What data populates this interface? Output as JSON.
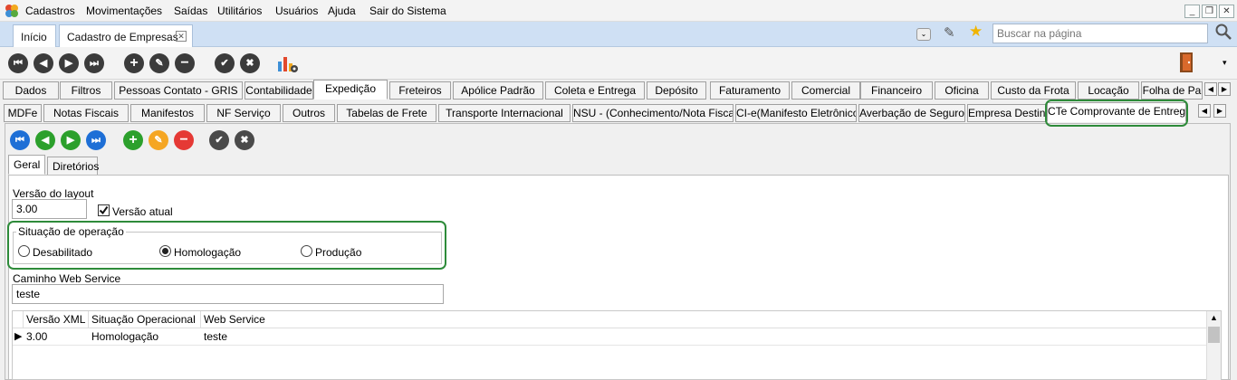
{
  "menu": {
    "items": [
      "Cadastros",
      "Movimentações",
      "Saídas",
      "Utilitários",
      "Usuários",
      "Ajuda",
      "Sair do Sistema"
    ]
  },
  "doc_tabs": {
    "home": "Início",
    "current": "Cadastro de Empresas"
  },
  "search": {
    "placeholder": "Buscar na página"
  },
  "row1_tabs": [
    "Dados",
    "Filtros",
    "Pessoas Contato - GRIS",
    "Contabilidade",
    "Expedição",
    "Freteiros",
    "Apólice Padrão",
    "Coleta e Entrega",
    "Depósito",
    "Faturamento",
    "Comercial",
    "Financeiro",
    "Oficina",
    "Custo da Frota",
    "Locação",
    "Folha de Pa"
  ],
  "row2_tabs": [
    "MDFe",
    "Notas Fiscais",
    "Manifestos",
    "NF Serviço",
    "Outros",
    "Tabelas de Frete",
    "Transporte Internacional",
    "NSU - (Conhecimento/Nota Fiscal)",
    "CI-e(Manifesto Eletrônico)",
    "Averbação de Seguro",
    "Empresa Destino",
    "CTe Comprovante de Entrega"
  ],
  "sub_tabs": {
    "geral": "Geral",
    "diretorios": "Diretórios"
  },
  "form": {
    "layout_label": "Versão do layout",
    "layout_value": "3.00",
    "versao_atual_label": "Versão atual",
    "situacao_label": "Situação de operação",
    "radio_desabilitado": "Desabilitado",
    "radio_homologacao": "Homologação",
    "radio_producao": "Produção",
    "caminho_label": "Caminho Web Service",
    "caminho_value": "teste"
  },
  "grid": {
    "headers": [
      "Versão XML",
      "Situação Operacional",
      "Web Service"
    ],
    "rows": [
      [
        "3.00",
        "Homologação",
        "teste"
      ]
    ]
  },
  "colors": {
    "accent_green": "#2e8b3a",
    "nav_blue": "#1e6fd6",
    "add_green": "#2ca02c",
    "edit_orange": "#f5a623",
    "delete_red": "#e53935"
  }
}
